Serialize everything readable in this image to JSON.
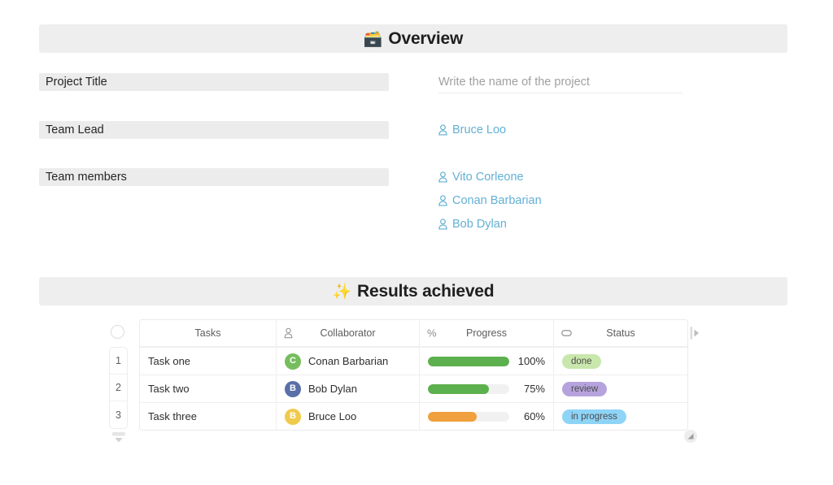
{
  "sections": {
    "overview": {
      "emoji": "🗃️",
      "title": "Overview",
      "emoji_name": "card-file-box-emoji"
    },
    "results": {
      "emoji": "✨",
      "title": "Results achieved",
      "emoji_name": "sparkles-emoji"
    }
  },
  "overview": {
    "fields": [
      {
        "label": "Project Title",
        "value": "Write the name of the project",
        "is_placeholder": true
      },
      {
        "label": "Team Lead",
        "value": "Bruce Loo",
        "is_placeholder": false
      },
      {
        "label": "Team members",
        "value": "",
        "is_placeholder": false
      }
    ],
    "team_lead": [
      {
        "name": "Bruce Loo"
      }
    ],
    "team_members": [
      {
        "name": "Vito Corleone"
      },
      {
        "name": "Conan Barbarian"
      },
      {
        "name": "Bob Dylan"
      }
    ]
  },
  "table": {
    "select_all_label": "",
    "columns": [
      {
        "label": "Tasks",
        "icon": null
      },
      {
        "label": "Collaborator",
        "icon": "person-icon"
      },
      {
        "label": "Progress",
        "icon": "percent-icon"
      },
      {
        "label": "Status",
        "icon": "label-pill-icon"
      }
    ],
    "row_numbers": [
      "1",
      "2",
      "3"
    ],
    "rows": [
      {
        "num": "1",
        "task": "Task one",
        "collaborator": "Conan Barbarian",
        "avatar_initial": "C",
        "avatar_color": "#76bd5e",
        "progress": 100,
        "progress_label": "100%",
        "progress_color": "#5cb04d",
        "status": "done",
        "status_color": "#c9e7ac"
      },
      {
        "num": "2",
        "task": "Task two",
        "collaborator": "Bob Dylan",
        "avatar_initial": "B",
        "avatar_color": "#5a6fa8",
        "progress": 75,
        "progress_label": "75%",
        "progress_color": "#5cb04d",
        "status": "review",
        "status_color": "#b6a3dd"
      },
      {
        "num": "3",
        "task": "Task three",
        "collaborator": "Bruce Loo",
        "avatar_initial": "B",
        "avatar_color": "#f0ca4d",
        "progress": 60,
        "progress_label": "60%",
        "progress_color": "#f0a03c",
        "status": "in progress",
        "status_color": "#8ed4f7"
      }
    ]
  },
  "colors": {
    "section_header_bg": "#eeeeee",
    "field_label_bg": "#ececec",
    "link_blue": "#62b0d4",
    "placeholder_gray": "#a0a0a0",
    "border_gray": "#ebebeb"
  }
}
